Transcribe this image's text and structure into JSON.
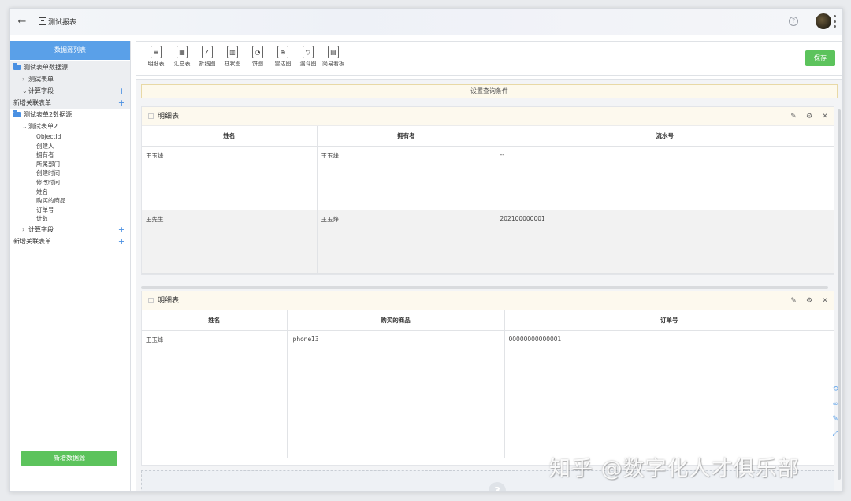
{
  "header": {
    "back_glyph": "←",
    "title": "测试报表",
    "help_glyph": "?"
  },
  "sidebar": {
    "title": "数据源列表",
    "tree": [
      {
        "label": "测试表单数据源",
        "kind": "folder",
        "indent": 0,
        "shade": true
      },
      {
        "label": "测试表单",
        "kind": "collapsed",
        "indent": 1,
        "shade": true
      },
      {
        "label": "计算字段",
        "kind": "expanded",
        "indent": 1,
        "shade": true,
        "plus": true
      },
      {
        "label": "新增关联表单",
        "kind": "plain",
        "indent": 0,
        "shade": true,
        "plus": true
      },
      {
        "label": "测试表单2数据源",
        "kind": "folder",
        "indent": 0,
        "shade": false
      },
      {
        "label": "测试表单2",
        "kind": "expanded",
        "indent": 1,
        "shade": false
      }
    ],
    "fields": [
      "ObjectId",
      "创建人",
      "拥有者",
      "所属部门",
      "创建时间",
      "修改时间",
      "姓名",
      "购买的商品",
      "订单号",
      "计数"
    ],
    "tree_tail": [
      {
        "label": "计算字段",
        "kind": "collapsed",
        "indent": 1,
        "plus": true
      },
      {
        "label": "新增关联表单",
        "kind": "plain",
        "indent": 0,
        "plus": true
      }
    ],
    "add_button": "新增数据源"
  },
  "toolbar": {
    "tools": [
      {
        "label": "明细表",
        "icon": "detail-table-icon",
        "glyph": "≡"
      },
      {
        "label": "汇总表",
        "icon": "summary-table-icon",
        "glyph": "▦"
      },
      {
        "label": "折线图",
        "icon": "line-chart-icon",
        "glyph": "∠"
      },
      {
        "label": "柱状图",
        "icon": "bar-chart-icon",
        "glyph": "▥"
      },
      {
        "label": "饼图",
        "icon": "pie-chart-icon",
        "glyph": "◔"
      },
      {
        "label": "雷达图",
        "icon": "radar-chart-icon",
        "glyph": "⊕"
      },
      {
        "label": "漏斗图",
        "icon": "funnel-chart-icon",
        "glyph": "▽"
      },
      {
        "label": "简易看板",
        "icon": "dashboard-icon",
        "glyph": "▤"
      }
    ],
    "save_label": "保存"
  },
  "canvas": {
    "query_label": "设置查询条件",
    "panel1": {
      "title": "明细表",
      "columns": [
        "姓名",
        "拥有者",
        "流水号"
      ],
      "rows": [
        [
          "王玉烽",
          "王玉烽",
          "--"
        ],
        [
          "王先生",
          "王玉烽",
          "202100000001"
        ]
      ]
    },
    "panel2": {
      "title": "明细表",
      "columns": [
        "姓名",
        "购买的商品",
        "订单号"
      ],
      "rows": [
        [
          "王玉烽",
          "iphone13",
          "00000000000001"
        ]
      ]
    },
    "dropzone_number": "3"
  },
  "watermark": "知乎 @数字化人才俱乐部",
  "colors": {
    "primary": "#5aa0e8",
    "success": "#5cc35c",
    "panel_header": "#fdf9ee"
  }
}
